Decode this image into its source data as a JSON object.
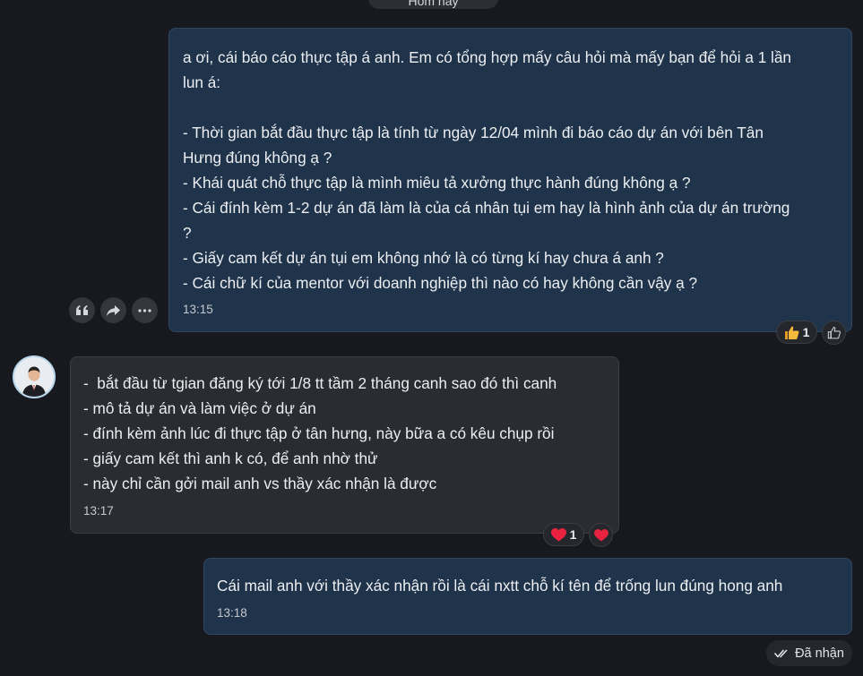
{
  "date_divider": "Hôm nay",
  "messages": [
    {
      "lines": [
        "a ơi, cái báo cáo thực tập á anh. Em có tổng hợp mấy câu hỏi mà mấy bạn để hỏi a 1 lần",
        "lun á:",
        "",
        "- Thời gian bắt đầu thực tập là tính từ ngày 12/04 mình đi báo cáo dự án với bên Tân",
        "Hưng đúng không ạ ?",
        "- Khái quát chỗ thực tập là mình miêu tả xưởng thực hành đúng không ạ ?",
        "- Cái đính kèm 1-2 dự án đã làm là của cá nhân tụi em hay là hình ảnh của dự án trường",
        "?",
        "- Giấy cam kết dự án tụi em không nhớ là có từng kí hay chưa á anh ?",
        "- Cái chữ kí của mentor với doanh nghiệp thì nào có hay không cần vậy ạ ?"
      ],
      "time": "13:15",
      "reaction": {
        "icon": "thumbs-up",
        "count": "1"
      }
    },
    {
      "lines": [
        "-  bắt đầu từ tgian đăng ký tới 1/8 tt tầm 2 tháng canh sao đó thì canh",
        "- mô tả dự án và làm việc ở dự án",
        "- đính kèm ảnh lúc đi thực tập ở tân hưng, này bữa a có kêu chụp rồi",
        "- giấy cam kết thì anh k có, để anh nhờ thử",
        "- này chỉ cần gởi mail anh vs thầy xác nhận là được"
      ],
      "time": "13:17",
      "reaction": {
        "icon": "heart",
        "count": "1"
      }
    },
    {
      "lines": [
        "Cái mail anh với thầy xác nhận rồi là cái nxtt chỗ kí tên để trống lun đúng hong anh"
      ],
      "time": "13:18"
    }
  ],
  "status": "Đã nhận",
  "colors": {
    "accent_blue": "#1f344b",
    "heart": "#e8223f",
    "thumb": "#f5b93b"
  }
}
